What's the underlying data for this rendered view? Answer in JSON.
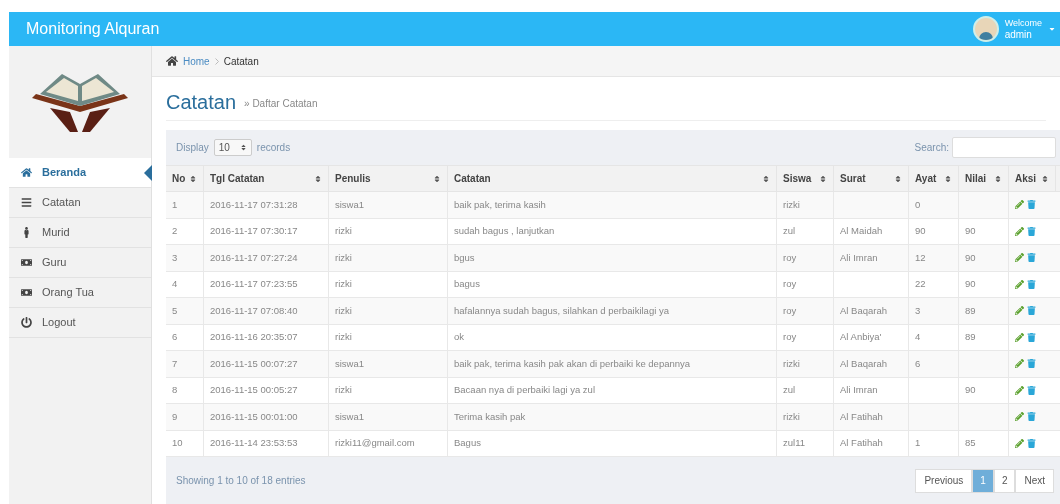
{
  "header": {
    "title": "Monitoring Alquran",
    "greeting": "Welcome",
    "user": "admin"
  },
  "sidebar": {
    "items": [
      {
        "label": "Beranda",
        "selected": true
      },
      {
        "label": "Catatan",
        "selected": false
      },
      {
        "label": "Murid",
        "selected": false
      },
      {
        "label": "Guru",
        "selected": false
      },
      {
        "label": "Orang Tua",
        "selected": false
      },
      {
        "label": "Logout",
        "selected": false
      }
    ]
  },
  "breadcrumb": [
    "Home",
    "Catatan"
  ],
  "page": {
    "title": "Catatan",
    "subtitle": "» Daftar Catatan"
  },
  "table": {
    "length": {
      "before": "Display",
      "value": "10",
      "after": "records"
    },
    "search_label": "Search:",
    "columns": [
      "No",
      "Tgl Catatan",
      "Penulis",
      "Catatan",
      "Siswa",
      "Surat",
      "Ayat",
      "Nilai",
      "Aksi"
    ],
    "rows": [
      {
        "no": "1",
        "date": "2016-11-17 07:31:28",
        "author": "siswa1",
        "note": "baik pak, terima kasih",
        "student": "rizki",
        "ayat": "0"
      },
      {
        "no": "2",
        "date": "2016-11-17 07:30:17",
        "author": "rizki",
        "note": "sudah bagus , lanjutkan",
        "student": "zul",
        "surah": "Al Maidah",
        "ayat": "90",
        "score": "90"
      },
      {
        "no": "3",
        "date": "2016-11-17 07:27:24",
        "author": "rizki",
        "note": "bgus",
        "student": "roy",
        "surah": "Ali Imran",
        "ayat": "12",
        "score": "90"
      },
      {
        "no": "4",
        "date": "2016-11-17 07:23:55",
        "author": "rizki",
        "note": "bagus",
        "student": "roy",
        "ayat": "22",
        "score": "90"
      },
      {
        "no": "5",
        "date": "2016-11-17 07:08:40",
        "author": "rizki",
        "note": "hafalannya sudah bagus, silahkan d perbaikilagi ya",
        "student": "roy",
        "surah": "Al Baqarah",
        "ayat": "3",
        "score": "89"
      },
      {
        "no": "6",
        "date": "2016-11-16 20:35:07",
        "author": "rizki",
        "note": "ok",
        "student": "roy",
        "surah": "Al Anbiya'",
        "ayat": "4",
        "score": "89"
      },
      {
        "no": "7",
        "date": "2016-11-15 00:07:27",
        "author": "siswa1",
        "note": "baik pak, terima kasih pak akan di perbaiki ke depannya",
        "student": "rizki",
        "surah": "Al Baqarah",
        "ayat": "6"
      },
      {
        "no": "8",
        "date": "2016-11-15 00:05:27",
        "author": "rizki",
        "note": "Bacaan nya di perbaiki lagi ya zul",
        "student": "zul",
        "surah": "Ali Imran",
        "score": "90"
      },
      {
        "no": "9",
        "date": "2016-11-15 00:01:00",
        "author": "siswa1",
        "note": "Terima kasih pak",
        "student": "rizki",
        "surah": "Al Fatihah"
      },
      {
        "no": "10",
        "date": "2016-11-14 23:53:53",
        "author": "rizki11@gmail.com",
        "note": "Bagus",
        "student": "zul11",
        "surah": "Al Fatihah",
        "ayat": "1",
        "score": "85"
      }
    ],
    "info": "Showing 1 to 10 of 18 entries",
    "pagination": [
      {
        "label": "Previous",
        "kind": "nav",
        "selected": false
      },
      {
        "label": "1",
        "kind": "page",
        "selected": true
      },
      {
        "label": "2",
        "kind": "page",
        "selected": false
      },
      {
        "label": "Next",
        "kind": "nav",
        "selected": false
      }
    ]
  }
}
